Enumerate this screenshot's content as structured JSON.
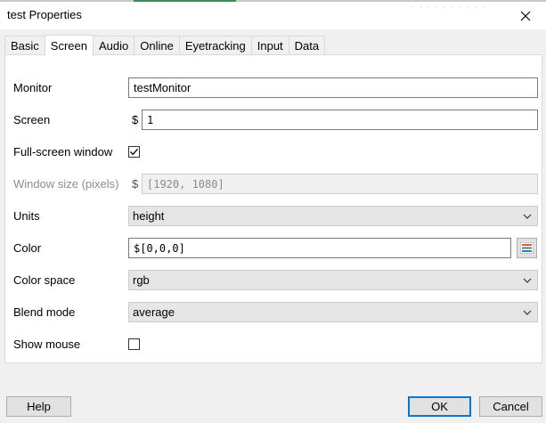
{
  "window": {
    "title": "test Properties",
    "ghost_text": "· · · · · · · · · ·"
  },
  "tabs": [
    "Basic",
    "Screen",
    "Audio",
    "Online",
    "Eyetracking",
    "Input",
    "Data"
  ],
  "active_tab": "Screen",
  "fields": {
    "monitor": {
      "label": "Monitor",
      "value": "testMonitor"
    },
    "screen": {
      "label": "Screen",
      "prefix": "$",
      "value": "1"
    },
    "fullscreen": {
      "label": "Full-screen window",
      "checked": true
    },
    "window_size": {
      "label": "Window size (pixels)",
      "prefix": "$",
      "value": "[1920, 1080]"
    },
    "units": {
      "label": "Units",
      "value": "height"
    },
    "color": {
      "label": "Color",
      "value": "$[0,0,0]"
    },
    "color_space": {
      "label": "Color space",
      "value": "rgb"
    },
    "blend_mode": {
      "label": "Blend mode",
      "value": "average"
    },
    "show_mouse": {
      "label": "Show mouse",
      "checked": false
    }
  },
  "buttons": {
    "help": "Help",
    "ok": "OK",
    "cancel": "Cancel"
  },
  "icons": {
    "close": "close-icon",
    "chevron": "chevron-down-icon",
    "check": "checkmark-icon",
    "color_picker": "color-picker-icon"
  },
  "colors": {
    "primary_border": "#0078d7",
    "title_accent": "#3a8a5a"
  }
}
